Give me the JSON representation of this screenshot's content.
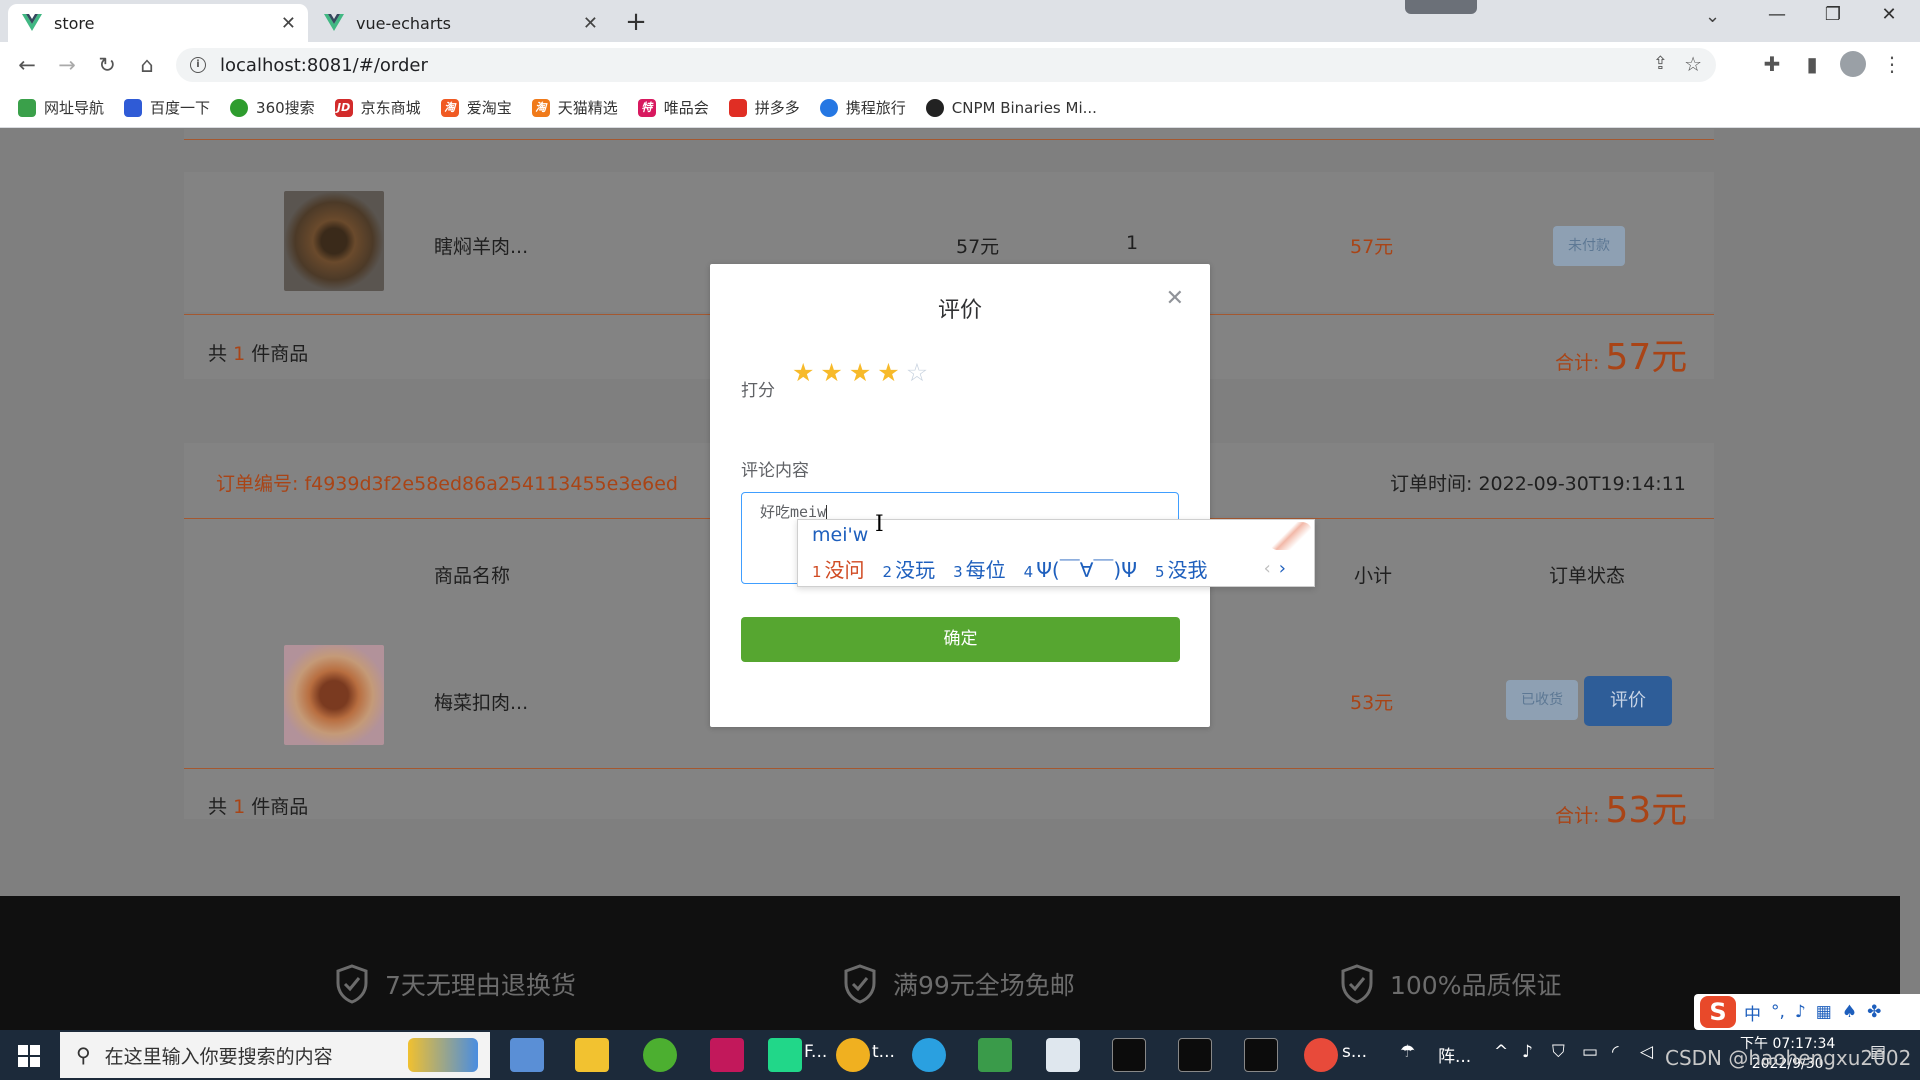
{
  "browser": {
    "tabs": [
      {
        "title": "store",
        "active": true
      },
      {
        "title": "vue-echarts",
        "active": false
      }
    ],
    "url": "localhost:8081/#/order",
    "bookmarks": [
      "网址导航",
      "百度一下",
      "360搜索",
      "京东商城",
      "爱淘宝",
      "天猫精选",
      "唯品会",
      "拼多多",
      "携程旅行",
      "CNPM Binaries Mi..."
    ]
  },
  "orders": [
    {
      "item_name": "瞎焖羊肉...",
      "price": "57元",
      "quantity": "1",
      "subtotal": "57元",
      "status": "未付款",
      "count_prefix": "共",
      "count": "1",
      "count_suffix": "件商品",
      "total_label": "合计:",
      "total": "57元"
    },
    {
      "order_no": "订单编号: f4939d3f2e58ed86a254113455e3e6ed",
      "order_time": "订单时间: 2022-09-30T19:14:11",
      "columns": {
        "name": "商品名称",
        "subtotal": "小计",
        "status": "订单状态"
      },
      "item_name": "梅菜扣肉...",
      "subtotal": "53元",
      "status": "已收货",
      "action": "评价",
      "count_prefix": "共",
      "count": "1",
      "count_suffix": "件商品",
      "total_label": "合计:",
      "total": "53元"
    }
  ],
  "footer": {
    "promises": [
      "7天无理由退换货",
      "满99元全场免邮",
      "100%品质保证"
    ]
  },
  "dialog": {
    "title": "评价",
    "score_label": "打分",
    "rating": 4,
    "rating_max": 5,
    "comment_label": "评论内容",
    "comment_value": "好吃meiw",
    "confirm": "确定"
  },
  "ime": {
    "pinyin": "mei'w",
    "candidates": [
      {
        "num": "1",
        "text": "没问"
      },
      {
        "num": "2",
        "text": "没玩"
      },
      {
        "num": "3",
        "text": "每位"
      },
      {
        "num": "4",
        "text": "Ψ(￣∀￣)Ψ"
      },
      {
        "num": "5",
        "text": "没我"
      }
    ]
  },
  "taskbar": {
    "search_placeholder": "在这里输入你要搜索的内容",
    "apps": [
      "F...",
      "t...",
      "s..."
    ],
    "weather": "阵...",
    "ime_lang": "中",
    "time": "下午 07:17:34",
    "date": "2022/9/30",
    "watermark": "CSDN @haohengxu2002"
  },
  "colors": {
    "accent_green": "#56a630",
    "accent_blue": "#409eff",
    "star": "#f7ba2a",
    "price_orange": "#a94416"
  }
}
